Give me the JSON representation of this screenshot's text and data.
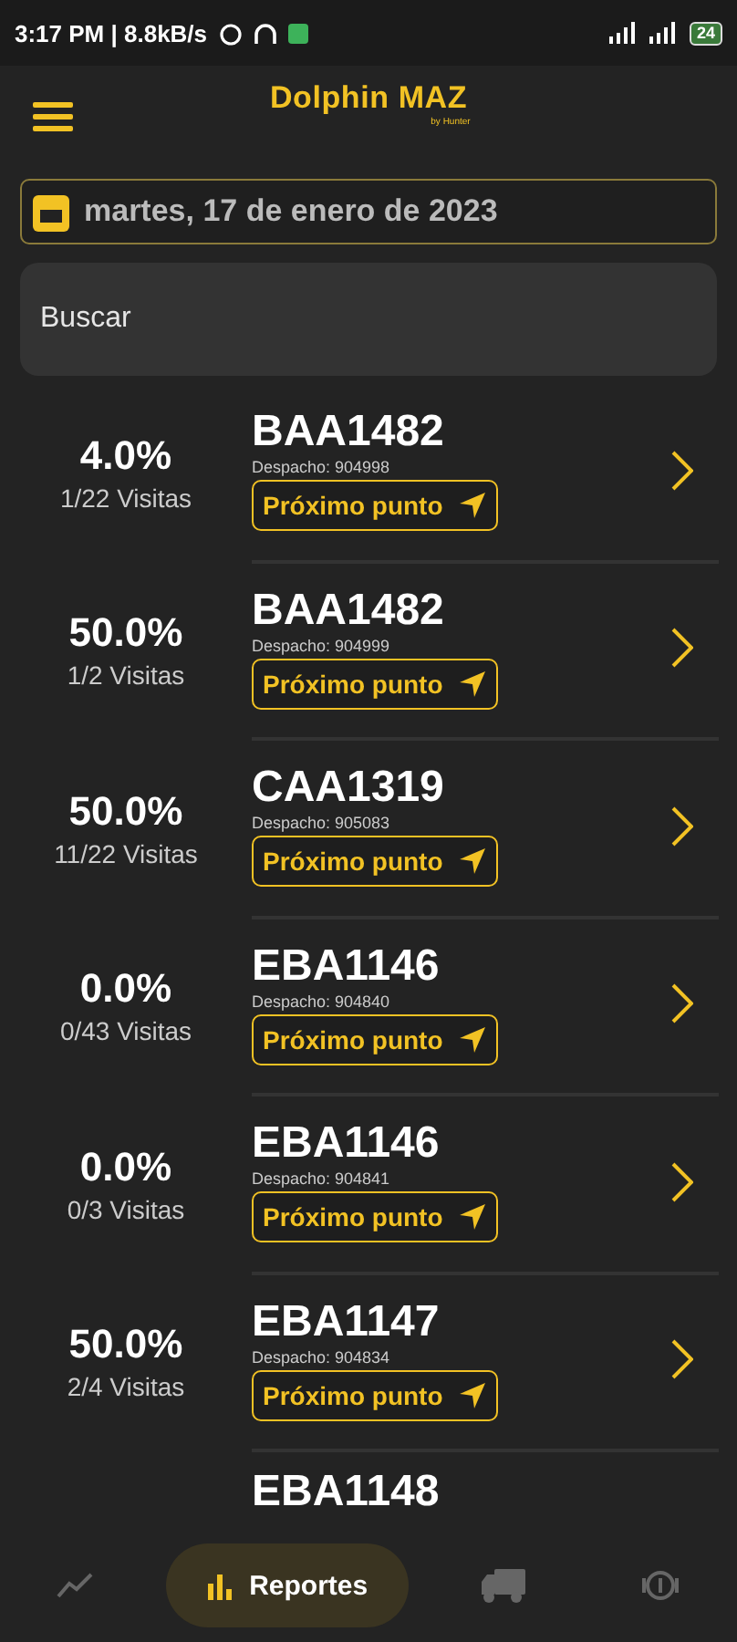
{
  "status_bar": {
    "time": "3:17 PM | 8.8kB/s",
    "battery": "24"
  },
  "header": {
    "title": "Dolphin MAZ",
    "subtitle": "by Hunter"
  },
  "date_field": {
    "value": "martes, 17 de enero de 2023"
  },
  "search": {
    "placeholder": "Buscar"
  },
  "routes": [
    {
      "percent": "4.0%",
      "visits": "1/22 Visitas",
      "plate": "BAA1482",
      "dispatch": "Despacho: 904998",
      "action": "Próximo punto"
    },
    {
      "percent": "50.0%",
      "visits": "1/2 Visitas",
      "plate": "BAA1482",
      "dispatch": "Despacho: 904999",
      "action": "Próximo punto"
    },
    {
      "percent": "50.0%",
      "visits": "11/22 Visitas",
      "plate": "CAA1319",
      "dispatch": "Despacho: 905083",
      "action": "Próximo punto"
    },
    {
      "percent": "0.0%",
      "visits": "0/43 Visitas",
      "plate": "EBA1146",
      "dispatch": "Despacho: 904840",
      "action": "Próximo punto"
    },
    {
      "percent": "0.0%",
      "visits": "0/3 Visitas",
      "plate": "EBA1146",
      "dispatch": "Despacho: 904841",
      "action": "Próximo punto"
    },
    {
      "percent": "50.0%",
      "visits": "2/4 Visitas",
      "plate": "EBA1147",
      "dispatch": "Despacho: 904834",
      "action": "Próximo punto"
    },
    {
      "plate": "EBA1148"
    }
  ],
  "bottom_nav": [
    {
      "selected": false
    },
    {
      "label": "Reportes",
      "selected": true
    },
    {
      "selected": false
    },
    {
      "selected": false
    }
  ]
}
